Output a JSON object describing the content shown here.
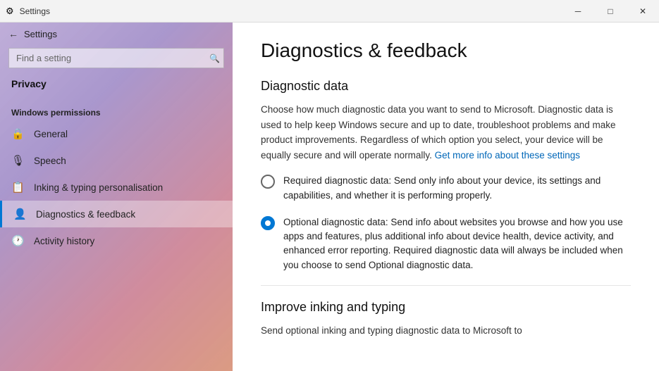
{
  "titleBar": {
    "title": "Settings",
    "minimizeLabel": "─",
    "maximizeLabel": "□",
    "closeLabel": "✕"
  },
  "sidebar": {
    "backArrow": "←",
    "appTitle": "Settings",
    "search": {
      "placeholder": "Find a setting",
      "searchIcon": "🔍"
    },
    "sectionHeader": "Privacy",
    "windowsPermissionsLabel": "Windows permissions",
    "navItems": [
      {
        "id": "general",
        "label": "General",
        "icon": "🔒"
      },
      {
        "id": "speech",
        "label": "Speech",
        "icon": "🎙"
      },
      {
        "id": "inking",
        "label": "Inking & typing personalisation",
        "icon": "📋"
      },
      {
        "id": "diagnostics",
        "label": "Diagnostics & feedback",
        "icon": "👤",
        "active": true
      },
      {
        "id": "activity",
        "label": "Activity history",
        "icon": "🕐"
      }
    ]
  },
  "main": {
    "pageTitle": "Diagnostics & feedback",
    "diagnosticDataSection": {
      "title": "Diagnostic data",
      "description": "Choose how much diagnostic data you want to send to Microsoft. Diagnostic data is used to help keep Windows secure and up to date, troubleshoot problems and make product improvements. Regardless of which option you select, your device will be equally secure and will operate normally.",
      "linkText": "Get more info about these settings",
      "options": [
        {
          "id": "required",
          "label": "Required diagnostic data: Send only info about your device, its settings and capabilities, and whether it is performing properly.",
          "selected": false
        },
        {
          "id": "optional",
          "label": "Optional diagnostic data: Send info about websites you browse and how you use apps and features, plus additional info about device health, device activity, and enhanced error reporting. Required diagnostic data will always be included when you choose to send Optional diagnostic data.",
          "selected": true
        }
      ]
    },
    "improveSection": {
      "title": "Improve inking and typing",
      "description": "Send optional inking and typing diagnostic data to Microsoft to"
    }
  }
}
